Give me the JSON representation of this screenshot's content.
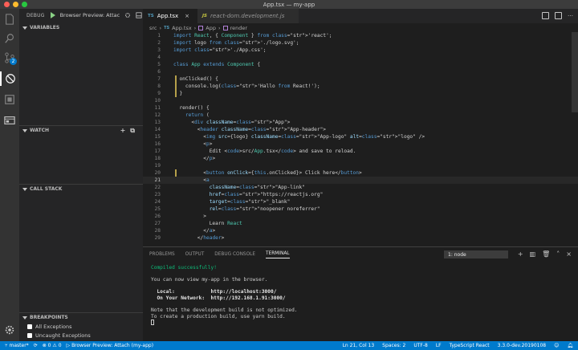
{
  "window": {
    "title": "App.tsx — my-app"
  },
  "activity": {
    "scm_badge": "2"
  },
  "debug": {
    "label": "DEBUG",
    "config": "Browser Preview: Attac",
    "sections": {
      "variables": "VARIABLES",
      "watch": "WATCH",
      "call_stack": "CALL STACK",
      "breakpoints": "BREAKPOINTS"
    },
    "breakpoints": [
      {
        "label": "All Exceptions"
      },
      {
        "label": "Uncaught Exceptions"
      }
    ]
  },
  "tabs": [
    {
      "lang": "TS",
      "label": "App.tsx",
      "active": true
    },
    {
      "lang": "JS",
      "label": "react-dom.development.js",
      "active": false
    }
  ],
  "breadcrumb": {
    "folder": "src",
    "file": "App.tsx",
    "symbol": "App",
    "method": "render"
  },
  "code_lines": [
    {
      "n": "1",
      "text": "import React, { Component } from 'react';"
    },
    {
      "n": "2",
      "text": "import logo from './logo.svg';"
    },
    {
      "n": "3",
      "text": "import './App.css';"
    },
    {
      "n": "4",
      "text": ""
    },
    {
      "n": "5",
      "text": "class App extends Component {"
    },
    {
      "n": "6",
      "text": ""
    },
    {
      "n": "7",
      "text": "  onClicked() {"
    },
    {
      "n": "8",
      "text": "    console.log('Hallo from React!');"
    },
    {
      "n": "9",
      "text": "  }"
    },
    {
      "n": "10",
      "text": ""
    },
    {
      "n": "11",
      "text": "  render() {"
    },
    {
      "n": "12",
      "text": "    return ("
    },
    {
      "n": "13",
      "text": "      <div className=\"App\">"
    },
    {
      "n": "14",
      "text": "        <header className=\"App-header\">"
    },
    {
      "n": "15",
      "text": "          <img src={logo} className=\"App-logo\" alt=\"logo\" />"
    },
    {
      "n": "16",
      "text": "          <p>"
    },
    {
      "n": "17",
      "text": "            Edit <code>src/App.tsx</code> and save to reload."
    },
    {
      "n": "18",
      "text": "          </p>"
    },
    {
      "n": "19",
      "text": ""
    },
    {
      "n": "20",
      "text": "          <button onClick={this.onClicked}> Click here</button>"
    },
    {
      "n": "21",
      "text": "          <a"
    },
    {
      "n": "22",
      "text": "            className=\"App-link\""
    },
    {
      "n": "23",
      "text": "            href=\"https://reactjs.org\""
    },
    {
      "n": "24",
      "text": "            target=\"_blank\""
    },
    {
      "n": "25",
      "text": "            rel=\"noopener noreferrer\""
    },
    {
      "n": "26",
      "text": "          >"
    },
    {
      "n": "27",
      "text": "            Learn React"
    },
    {
      "n": "28",
      "text": "          </a>"
    },
    {
      "n": "29",
      "text": "        </header>"
    }
  ],
  "panel": {
    "tabs": [
      "PROBLEMS",
      "OUTPUT",
      "DEBUG CONSOLE",
      "TERMINAL"
    ],
    "terminal_select": "1: node",
    "terminal_lines": [
      "Compiled successfully!",
      "",
      "You can now view my-app in the browser.",
      "",
      "  Local:            http://localhost:3000/",
      "  On Your Network:  http://192.168.1.91:3000/",
      "",
      "Note that the development build is not optimized.",
      "To create a production build, use yarn build."
    ]
  },
  "status": {
    "branch": "master*",
    "errors": "0",
    "warnings": "0",
    "debug_target": "Browser Preview: Attach (my-app)",
    "position": "Ln 21, Col 13",
    "spaces": "Spaces: 2",
    "encoding": "UTF-8",
    "eol": "LF",
    "language": "TypeScript React",
    "version": "3.3.0-dev.20190108"
  },
  "colors": {
    "accent": "#007acc",
    "keyword": "#569cd6",
    "string": "#ce9178",
    "success": "#0dbc79"
  }
}
